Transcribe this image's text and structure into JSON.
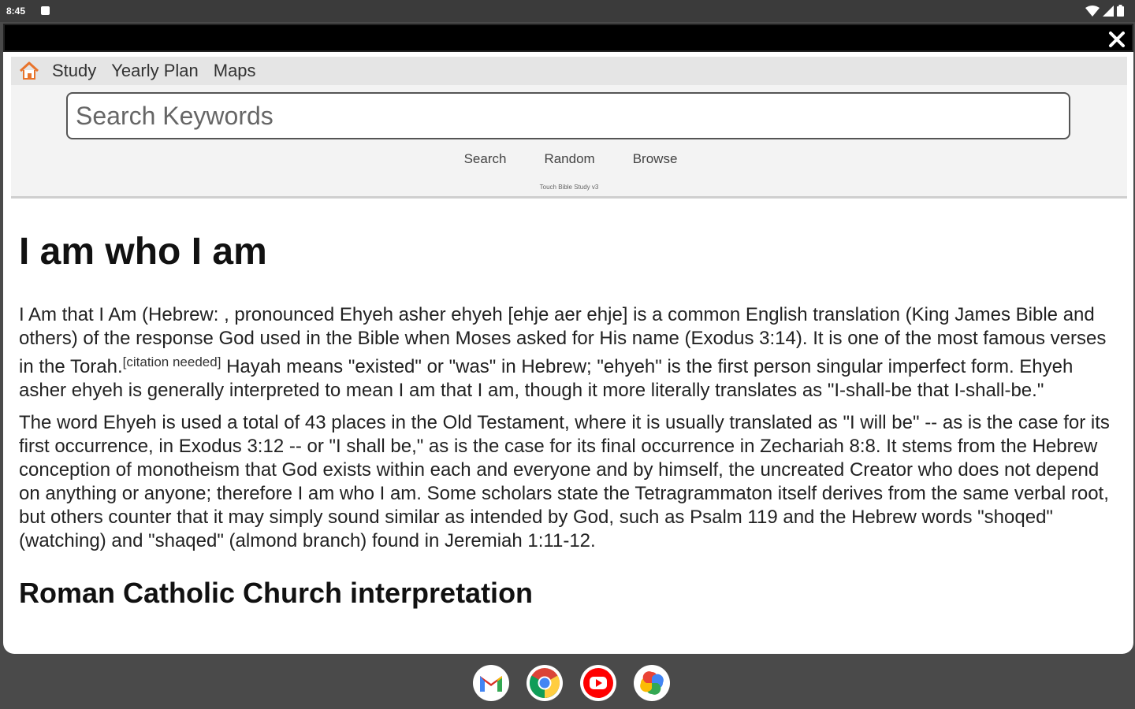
{
  "status_bar": {
    "time": "8:45"
  },
  "nav": {
    "home_icon": "home-icon",
    "links": [
      "Study",
      "Yearly Plan",
      "Maps"
    ]
  },
  "search": {
    "placeholder": "Search Keywords",
    "actions": [
      "Search",
      "Random",
      "Browse"
    ],
    "footnote": "Touch Bible Study v3"
  },
  "article": {
    "title": "I am who I am",
    "p1_a": "I Am that I Am (Hebrew: , pronounced Ehyeh asher ehyeh [ehje aer ehje] is a common English translation (King James Bible and others) of the response God used in the Bible when Moses asked for His name (Exodus 3:14). It is one of the most famous verses in the Torah.",
    "citation": "[citation needed]",
    "p1_b": " Hayah means \"existed\" or \"was\" in Hebrew; \"ehyeh\" is the first person singular imperfect form. Ehyeh asher ehyeh is generally interpreted to mean I am that I am, though it more literally translates as \"I-shall-be that I-shall-be.\"",
    "p2": "The word Ehyeh is used a total of 43 places in the Old Testament, where it is usually translated as \"I will be\" -- as is the case for its first occurrence, in Exodus 3:12 -- or \"I shall be,\" as is the case for its final occurrence in Zechariah 8:8. It stems from the Hebrew conception of monotheism that God exists within each and everyone and by himself, the uncreated Creator who does not depend on anything or anyone; therefore I am who I am. Some scholars state the Tetragrammaton itself derives from the same verbal root, but others counter that it may simply sound similar as intended by God, such as Psalm 119 and the Hebrew words \"shoqed\" (watching) and \"shaqed\" (almond branch) found in Jeremiah 1:11-12.",
    "section_title": "Roman Catholic Church interpretation"
  },
  "dock": {
    "apps": [
      "gmail-icon",
      "chrome-icon",
      "youtube-icon",
      "photos-icon"
    ]
  }
}
